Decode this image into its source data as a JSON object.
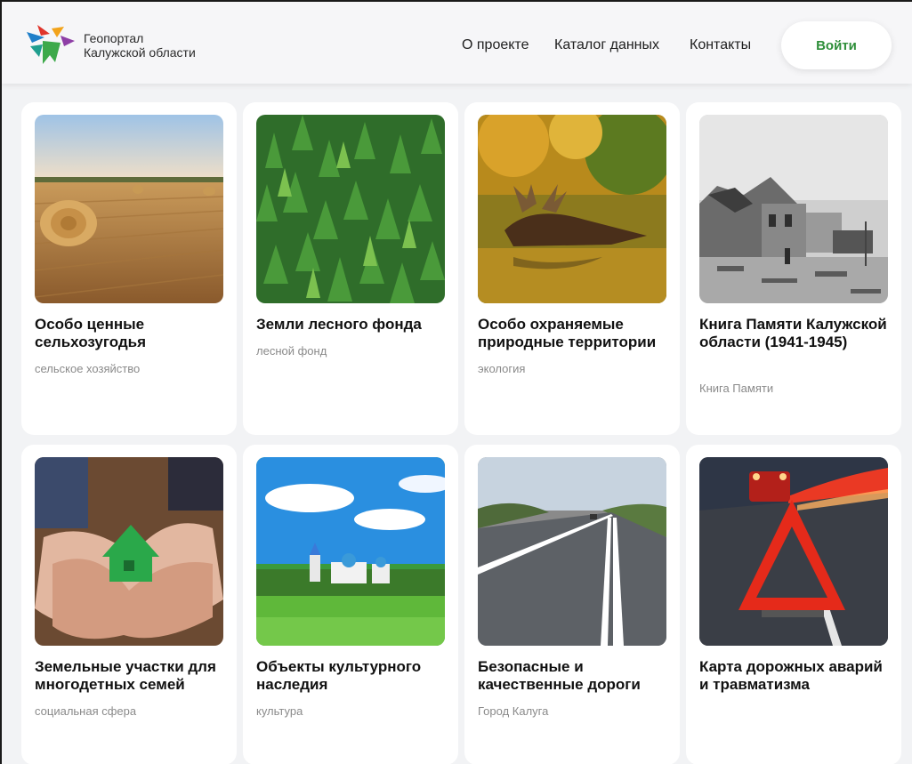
{
  "header": {
    "brand_line1": "Геопортал",
    "brand_line2": "Калужской области",
    "nav": [
      "О проекте",
      "Каталог данных",
      "Контакты"
    ],
    "login_label": "Войти",
    "login_color": "#2f8f3a"
  },
  "cards": [
    {
      "title": "Особо ценные сельхозугодья",
      "category": "сельское хозяйство",
      "image": "hay-field-image"
    },
    {
      "title": "Земли лесного фонда",
      "category": "лесной фонд",
      "image": "forest-aerial-image"
    },
    {
      "title": "Особо охраняемые природные территории",
      "category": "экология",
      "image": "moose-river-image"
    },
    {
      "title": "Книга Памяти Калужской области (1941-1945)",
      "category": "Книга Памяти",
      "image": "war-ruins-image"
    },
    {
      "title": "Земельные участки для многодетных семей",
      "category": "социальная сфера",
      "image": "hands-house-image"
    },
    {
      "title": "Объекты культурного наследия",
      "category": "культура",
      "image": "monastery-image"
    },
    {
      "title": "Безопасные и качественные дороги",
      "category": "Город Калуга",
      "image": "highway-image"
    },
    {
      "title": "Карта дорожных аварий и травматизма",
      "category": "",
      "image": "warning-triangle-image"
    }
  ]
}
